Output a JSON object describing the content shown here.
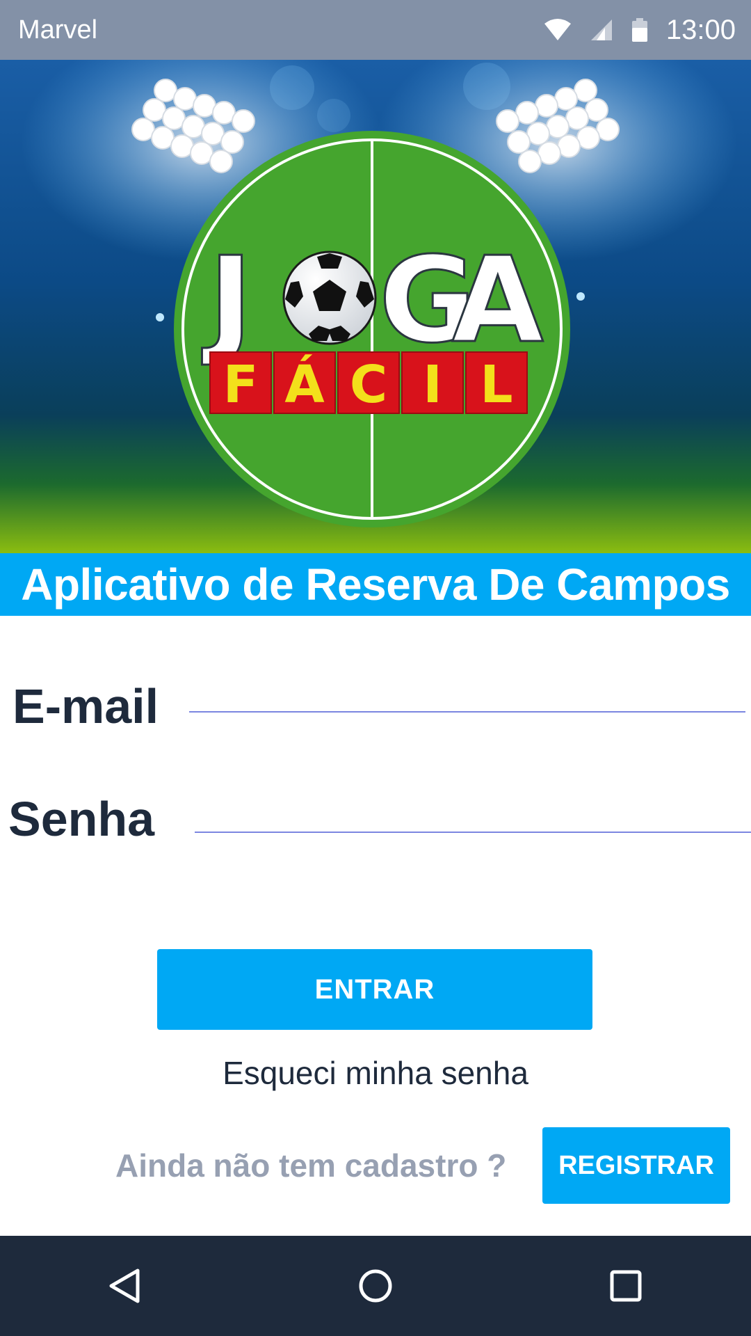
{
  "status_bar": {
    "carrier": "Marvel",
    "time": "13:00",
    "icons": [
      "wifi-icon",
      "cell-signal-icon",
      "battery-icon"
    ]
  },
  "hero": {
    "logo_word_top": "JOGA",
    "logo_word_bottom": "FÁCIL",
    "logo_letters_top": [
      "J",
      "G",
      "A"
    ],
    "logo_letters_bottom": [
      "F",
      "Á",
      "C",
      "I",
      "L"
    ]
  },
  "banner": {
    "text": "Aplicativo de Reserva De Campos"
  },
  "login": {
    "email_label": "E-mail",
    "email_value": "",
    "password_label": "Senha",
    "password_value": "",
    "submit_label": "ENTRAR",
    "forgot_label": "Esqueci minha senha",
    "signup_prompt": "Ainda não tem cadastro ?",
    "register_label": "REGISTRAR"
  },
  "navigation": {
    "icons": [
      "back-icon",
      "home-icon",
      "recents-icon"
    ]
  },
  "colors": {
    "accent": "#00a8f4",
    "status_bar": "#8391a7",
    "nav_bar": "#1e2a3c",
    "text_dark": "#1e2a3c",
    "text_muted": "#97a0b2",
    "field_green": "#45a52e",
    "logo_red": "#d8121b",
    "logo_yellow": "#f3e01b"
  }
}
